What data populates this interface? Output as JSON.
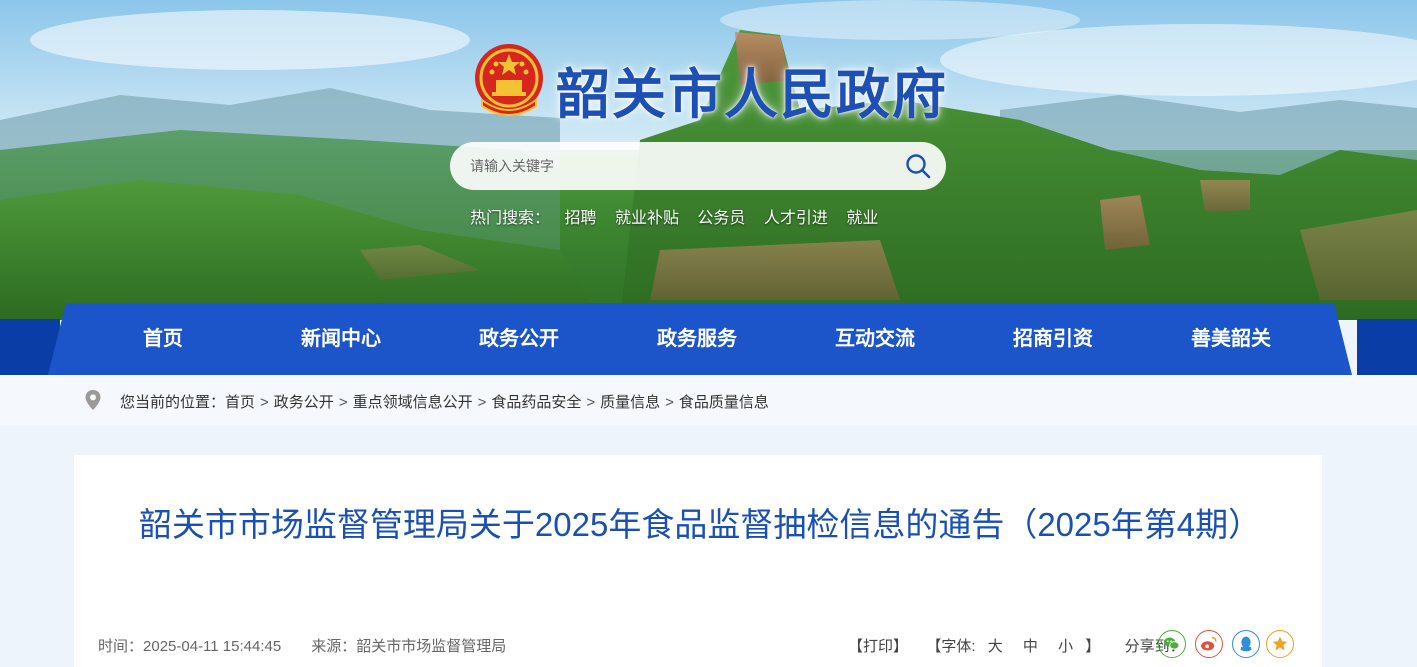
{
  "header": {
    "site_title": "韶关市人民政府",
    "search": {
      "placeholder": "请输入关键字"
    },
    "hot_search": {
      "label": "热门搜索：",
      "keywords": [
        "招聘",
        "就业补贴",
        "公务员",
        "人才引进",
        "就业"
      ]
    }
  },
  "nav": {
    "items": [
      "首页",
      "新闻中心",
      "政务公开",
      "政务服务",
      "互动交流",
      "招商引资",
      "善美韶关"
    ],
    "active_index": 2
  },
  "breadcrumb": {
    "label": "您当前的位置：",
    "items": [
      "首页",
      "政务公开",
      "重点领域信息公开",
      "食品药品安全",
      "质量信息",
      "食品质量信息"
    ],
    "separator": ">"
  },
  "article": {
    "title": "韶关市市场监督管理局关于2025年食品监督抽检信息的通告（2025年第4期）",
    "time_label": "时间：",
    "time": "2025-04-11 15:44:45",
    "source_label": "来源：",
    "source": "韶关市市场监督管理局",
    "print_label": "【打印】",
    "font_label": "【字体:",
    "font_large": "大",
    "font_medium": "中",
    "font_small": "小",
    "font_close": "】",
    "share_label": "分享到："
  },
  "share_icons": [
    "wechat-icon",
    "weibo-icon",
    "qq-icon",
    "qzone-icon"
  ],
  "colors": {
    "nav_bg": "#1b55c9",
    "title_blue": "#1a50b4",
    "wechat": "#4caf3c",
    "weibo": "#e0533a",
    "qq": "#2f8fd8",
    "qzone": "#f0a21a"
  }
}
